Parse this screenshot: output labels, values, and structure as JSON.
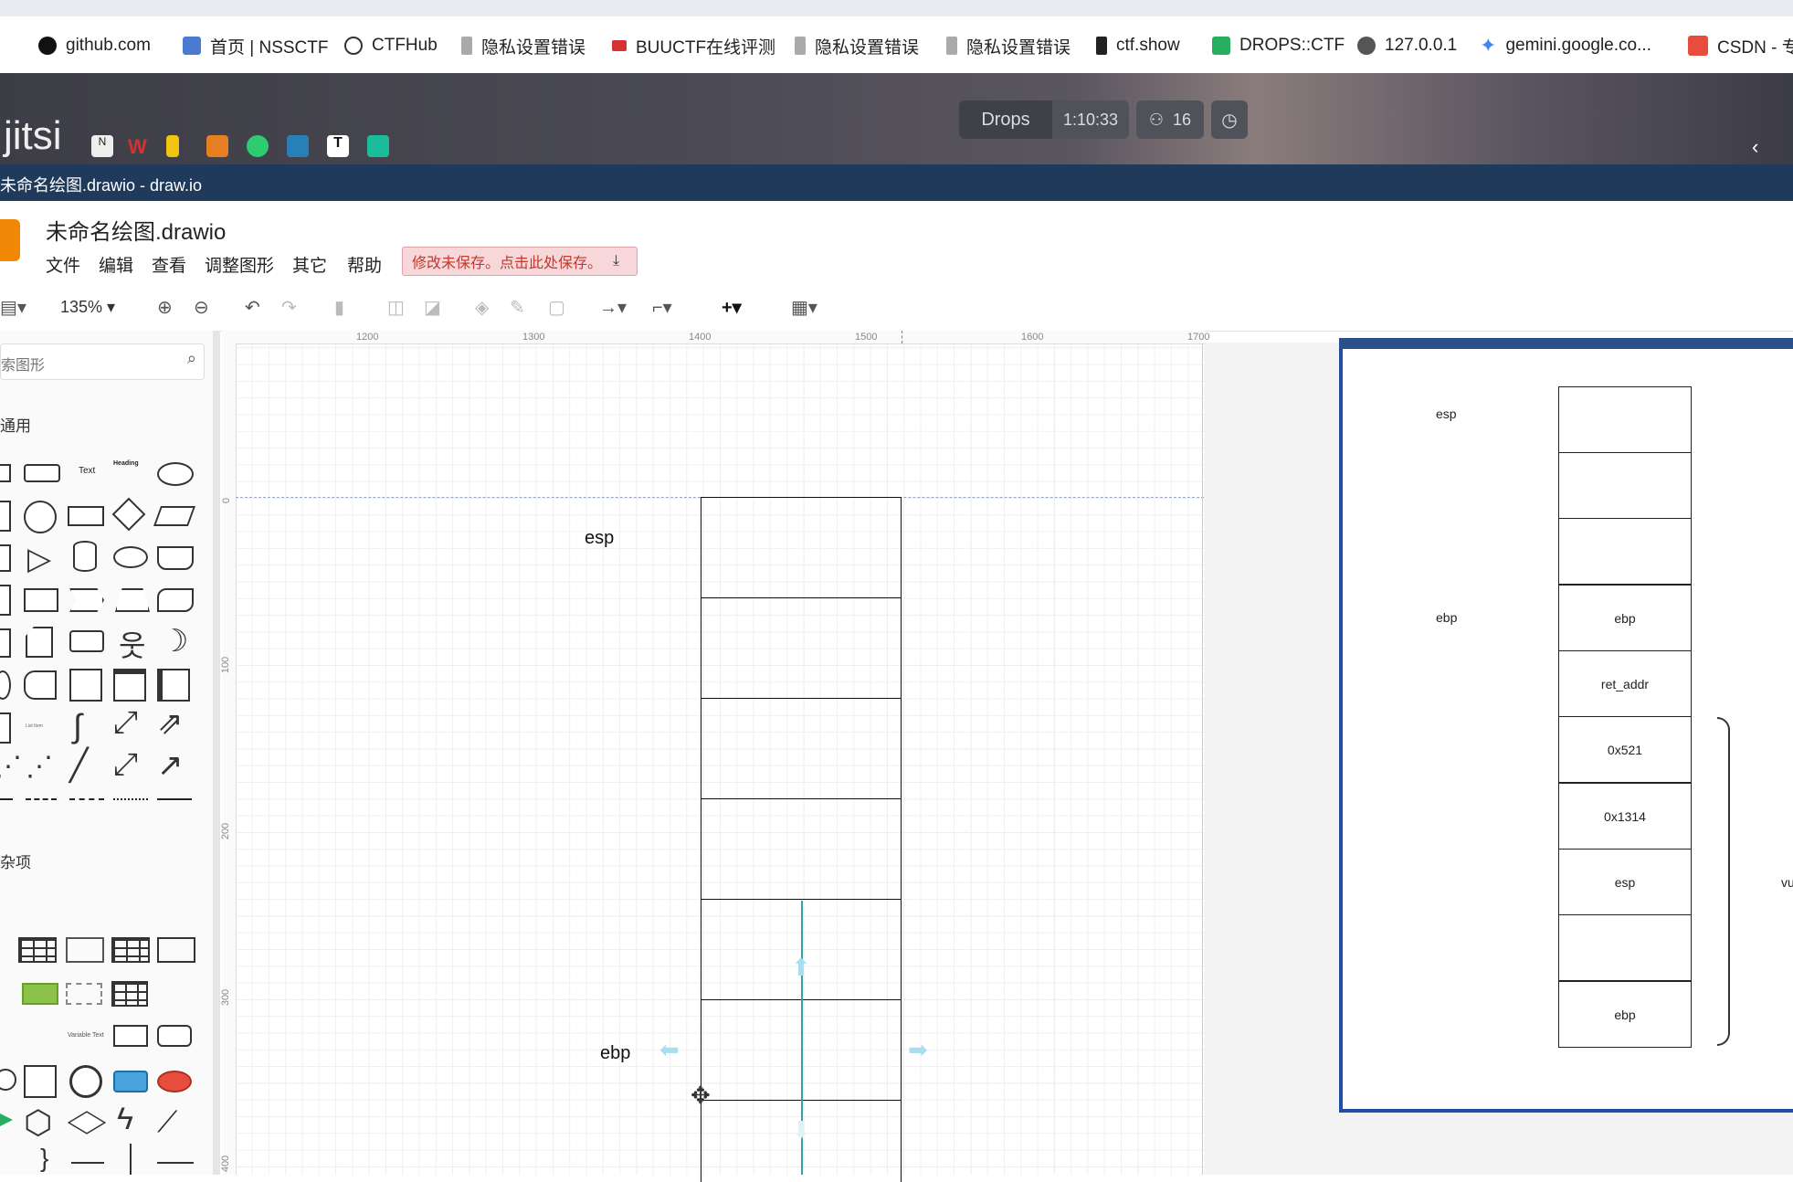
{
  "bookmarks": [
    {
      "label": "github.com",
      "color": "#111111"
    },
    {
      "label": "首页 | NSSCTF",
      "color": "#4a7bd0"
    },
    {
      "label": "CTFHub",
      "color": "#333333"
    },
    {
      "label": "隐私设置错误",
      "color": "#888888"
    },
    {
      "label": "BUUCTF在线评测",
      "color": "#d63031"
    },
    {
      "label": "隐私设置错误",
      "color": "#888888"
    },
    {
      "label": "隐私设置错误",
      "color": "#888888"
    },
    {
      "label": "ctf.show",
      "color": "#222222"
    },
    {
      "label": "DROPS::CTF",
      "color": "#27ae60"
    },
    {
      "label": "127.0.0.1",
      "color": "#333333"
    },
    {
      "label": "gemini.google.co...",
      "color": "#4285f4"
    },
    {
      "label": "CSDN - 专",
      "color": "#e74c3c"
    }
  ],
  "jitsi": {
    "logo": "jitsi",
    "room": "Drops",
    "timer": "1:10:33",
    "participants": "16"
  },
  "window": {
    "title": "未命名绘图.drawio - draw.io"
  },
  "document": {
    "title": "未命名绘图.drawio",
    "unsaved_label": "修改未保存。点击此处保存。"
  },
  "menu": [
    "文件",
    "编辑",
    "查看",
    "调整图形",
    "其它",
    "帮助"
  ],
  "toolbar": {
    "zoom": "135%"
  },
  "sidebar": {
    "search_placeholder": "索图形",
    "section_general": "通用",
    "section_misc": "杂项",
    "text_shape": "Text",
    "heading_shape": "Heading",
    "list_item": "List Item",
    "variable_text": "Variable Text"
  },
  "ruler": {
    "top": [
      "1200",
      "1300",
      "1400",
      "1500",
      "1600",
      "1700"
    ],
    "left": [
      "0",
      "100",
      "200",
      "300",
      "400"
    ]
  },
  "diagram": {
    "label_esp": "esp",
    "label_ebp": "ebp",
    "cell_count": 6
  },
  "overlay": {
    "label_esp": "esp",
    "label_ebp": "ebp",
    "cells": [
      "",
      "",
      "",
      "ebp",
      "ret_addr",
      "0x521",
      "0x1314",
      "esp",
      "",
      "ebp"
    ],
    "brace_text": "vu"
  }
}
